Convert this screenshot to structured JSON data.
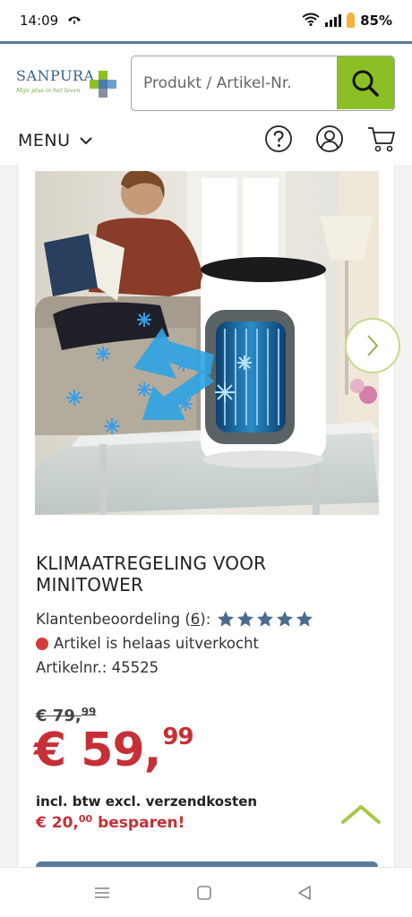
{
  "status_bar": {
    "time": "14:09",
    "battery": "85%"
  },
  "header": {
    "logo": {
      "name": "SANPURA",
      "tagline": "Mijn plus in het leven"
    },
    "search": {
      "placeholder": "Produkt / Artikel-Nr."
    },
    "menu_label": "MENU"
  },
  "product": {
    "title": "KLIMAATREGELING VOOR MINITOWER",
    "rating_label": "Klantenbeoordeling",
    "rating_count": "6",
    "rating_stars": 5,
    "stock_status": "Artikel is helaas uitverkocht",
    "article_number": "Artikelnr.: 45525",
    "old_price": {
      "main": "€ 79,",
      "cents": "99"
    },
    "new_price": {
      "main": "€ 59,",
      "cents": "99"
    },
    "tax_note": "incl. btw excl. verzendkosten",
    "savings": {
      "main": "€ 20,",
      "cents": "00",
      "suffix": "besparen!"
    }
  },
  "colors": {
    "brand_blue": "#3a5f8e",
    "accent_green": "#8cbf26",
    "price_red": "#c62f36",
    "star_blue": "#4a6b8c"
  }
}
